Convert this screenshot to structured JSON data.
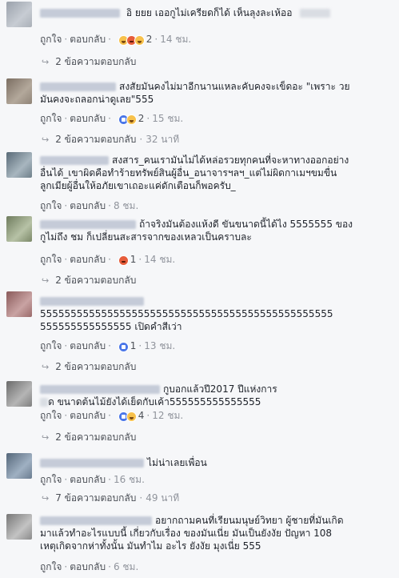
{
  "labels": {
    "like": "ถูกใจ",
    "reply": "ตอบกลับ",
    "sep": "·"
  },
  "comments": [
    {
      "text": "อิ ยยย เออกูไม่เครียดก็ได้ เห็นลุงละเห้ออ",
      "reaction_count": "2",
      "time": "14 ชม.",
      "replies": "2 ข้อความตอบกลับ"
    },
    {
      "text_line1": "สงสัยมันคงไม่มาอีกนานแหละคับคงจะเข็ดอะ \"เพราะ วย",
      "text_line2": "มันคงจะถลอกน่าดูเลย\"555",
      "reaction_count": "2",
      "time": "15 ชม.",
      "replies": "2 ข้อความตอบกลับ",
      "replies_time": "32 นาที"
    },
    {
      "text_line1": "สงสาร_คนเรามันไม่ได้หล่อรวยทุกคนที่จะหาทางออกอย่าง",
      "text_line2": "อื่นได้_เขาผิดคือทำร้ายทรัพย์สินผู้อื่น_อนาจารฯลฯ_แต่ไม่ผิดกาเมฯขมขื่น",
      "text_line3": "ลูกเมียผู้อื่นให้อภัยเขาเถอะแค่ดักเตือนก็พอครับ_",
      "time": "8 ชม."
    },
    {
      "text_line1": "ถ้าจริงมันต้องแห้งดี ขันขนาดนี้ได้ไง 5555555 ของ",
      "text_line2": "กูไม่ถึง ชม ก็เปลี่ยนสะสารจากของเหลวเป็นคราบละ",
      "reaction_count": "1",
      "time": "14 ชม.",
      "replies": "2 ข้อความตอบกลับ"
    },
    {
      "text_line1": "555555555555555555555555555555555555555555555555",
      "text_line2": "555555555555555 เปิดคำสีเว่า",
      "reaction_count": "1",
      "time": "13 ชม.",
      "replies": "2 ข้อความตอบกลับ"
    },
    {
      "text_line1": "กูบอกแล้วปี2017 ปีแห่งการ",
      "text_line2": "ด ขนาดต้นไม้ยังได้เย็ดกับเค้า555555555555555",
      "reaction_count": "4",
      "time": "12 ชม.",
      "replies": "2 ข้อความตอบกลับ"
    },
    {
      "text": "ไม่น่าเลยเพื่อน",
      "time": "16 ชม.",
      "replies": "7 ข้อความตอบกลับ",
      "replies_time": "49 นาที"
    },
    {
      "text_line1": "อยากถามคนที่เรียนมนุษย์วิทยา ผู้ชายที่มันเกิด",
      "text_line2": "มาแล้วทำอะไรแบบนี้ เกี่ยวกับเรื่อง ของมันเนี่ย มันเป็นยังงัย ปัญหา 108",
      "text_line3": "เหตุเกิดจากห่าทั้งนั้น มันทำไม อะไร ยังงัย มุงเนี่ย 555",
      "time": "6 ชม."
    }
  ]
}
